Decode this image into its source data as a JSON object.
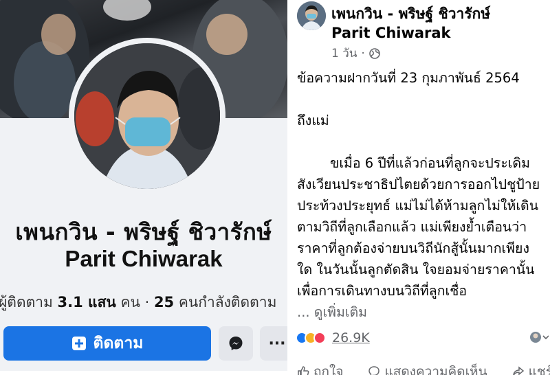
{
  "profile": {
    "name_th": "เพนกวิน - พริษฐ์ ชิวารักษ์",
    "name_en": "Parit Chiwarak",
    "followers_label": "ผู้ติดตาม",
    "followers_value": "3.1 แสน",
    "followers_unit": "คน",
    "separator": "·",
    "following_value": "25",
    "following_label": "คนกำลังติดตาม",
    "follow_button": "ติดตาม",
    "more_button": "···"
  },
  "post": {
    "author": "เพนกวิน - พริษฐ์ ชิวารักษ์ Parit Chiwarak",
    "author_line1": "เพนกวิน - พริษฐ์ ชิวารักษ์",
    "author_line2": "Parit Chiwarak",
    "time": "1 วัน",
    "privacy_icon": "globe-icon",
    "lines": [
      "ข้อความฝากวันที่ 23 กุมภาพันธ์ 2564",
      "",
      "ถึงแม่",
      "",
      "ขเมื่อ 6 ปีที่แล้วก่อนที่ลูกจะประเดิม",
      "สังเวียนประชาธิปไตยด้วยการออกไปชูป้าย",
      "ประท้วงประยุทธ์ แม่ไม่ได้ห้ามลูกไม่ให้เดิน",
      "ตามวิถีที่ลูกเลือกแล้ว แม่เพียงย้ำเตือนว่า",
      "ราคาที่ลูกต้องจ่ายบนวิถีนักสู้นั้นมากเพียง",
      "ใด ในวันนั้นลูกตัดสิน ใจยอมจ่ายราคานั้น",
      "เพื่อการเดินทางบนวิถีที่ลูกเชื่อ"
    ],
    "see_more": "... ดูเพิ่มเติม",
    "reaction_count": "26.9K",
    "actions": {
      "like": "ถูกใจ",
      "comment": "แสดงความคิดเห็น",
      "share": "แชร์"
    }
  },
  "colors": {
    "accent": "#1b74e4",
    "secondary_button": "#e4e6eb",
    "muted_text": "#65676b"
  }
}
